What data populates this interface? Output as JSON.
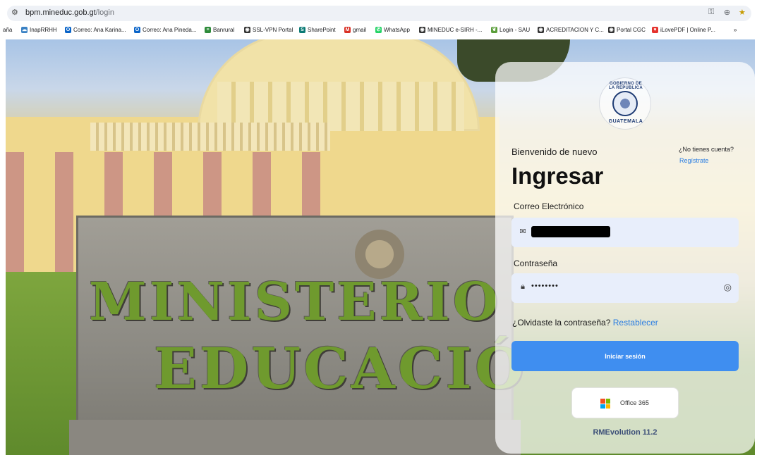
{
  "browser": {
    "url_host": "bpm.mineduc.gob.gt",
    "url_path": "/login",
    "bookmarks": [
      {
        "label": "aña",
        "icon": "",
        "color": "#ffffff"
      },
      {
        "label": "InapRRHH",
        "icon": "cloud-icon",
        "color": "#3b82c4"
      },
      {
        "label": "Correo: Ana Karina...",
        "icon": "outlook-icon",
        "color": "#0a64c8"
      },
      {
        "label": "Correo: Ana Pineda...",
        "icon": "outlook-icon",
        "color": "#0a64c8"
      },
      {
        "label": "Banrural",
        "icon": "bank-icon",
        "color": "#2e8b3a"
      },
      {
        "label": "SSL-VPN Portal",
        "icon": "globe-icon",
        "color": "#333333"
      },
      {
        "label": "SharePoint",
        "icon": "sharepoint-icon",
        "color": "#0b7a75"
      },
      {
        "label": "gmail",
        "icon": "gmail-icon",
        "color": "#d93025"
      },
      {
        "label": "WhatsApp",
        "icon": "whatsapp-icon",
        "color": "#25d366"
      },
      {
        "label": "MINEDUC e-SIRH -...",
        "icon": "globe-icon",
        "color": "#333333"
      },
      {
        "label": "Login - SAU",
        "icon": "leaf-icon",
        "color": "#5a9e3a"
      },
      {
        "label": "ACREDITACION Y C...",
        "icon": "globe-icon",
        "color": "#333333"
      },
      {
        "label": "Portal CGC",
        "icon": "globe-icon",
        "color": "#333333"
      },
      {
        "label": "iLovePDF | Online P...",
        "icon": "heart-icon",
        "color": "#e5322d"
      },
      {
        "label": "»",
        "icon": "",
        "color": "#ffffff"
      }
    ]
  },
  "scene": {
    "line1": "MINISTERIO",
    "line2": "EDUCACIÓ"
  },
  "login": {
    "seal_top": "GOBIERNO DE LA REPÚBLICA",
    "seal_bottom": "GUATEMALA",
    "welcome": "Bienvenido de nuevo",
    "no_account": "¿No tienes cuenta?",
    "register": "Regístrate",
    "title": "Ingresar",
    "email_label": "Correo Electrónico",
    "email_value": "",
    "password_label": "Contraseña",
    "password_value": "••••••••",
    "forgot_text": "¿Olvidaste la contraseña?",
    "forgot_link": "Restablecer",
    "submit": "Iniciar sesión",
    "office": "Office 365",
    "version": "RMEvolution 11.2"
  },
  "colors": {
    "primary": "#3f8ef0",
    "link": "#2a7de1"
  }
}
